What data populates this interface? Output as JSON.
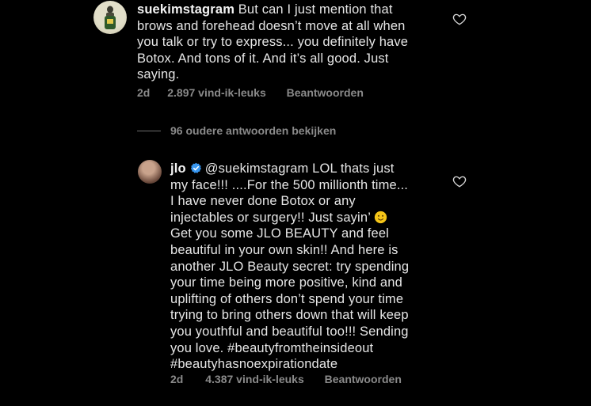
{
  "comments": {
    "parent": {
      "username": "suekimstagram",
      "lines": [
        " But can I just mention that",
        "brows and forehead doesn’t move at all when",
        "you talk or try to express... you definitely have",
        "Botox. And tons of it. And it’s all good.  Just",
        "saying."
      ],
      "time": "2d",
      "likes": "2.897 vind-ik-leuks",
      "reply_label": "Beantwoorden",
      "avatar_icon": "avatar-icon"
    },
    "view_replies_label": "96 oudere antwoorden bekijken",
    "reply": {
      "username": "jlo",
      "mention": "@suekimstagram",
      "lines": [
        "  LOL thats just",
        "my face!!! ....For the 500 millionth time...",
        "I have never done Botox or any",
        "injectables or surgery!! Just sayin’",
        "Get you some JLO BEAUTY and feel",
        "beautiful in your own skin!! And here is",
        "another JLO Beauty secret: try spending",
        "your time being more positive, kind and",
        "uplifting of others don’t spend your time",
        "trying to bring others down that will keep",
        "you youthful and beautiful too!!! Sending",
        "you love. #beautyfromtheinsideout",
        "#beautyhasnoexpirationdate"
      ],
      "time": "2d",
      "likes": "4.387 vind-ik-leuks",
      "reply_label": "Beantwoorden",
      "verified": true,
      "emoji": "slightly-smiling-face"
    }
  },
  "colors": {
    "background": "#000000",
    "text": "#e6e6e6",
    "meta": "#8a8a8a",
    "verified": "#3897f0",
    "emoji": "#f5c518"
  }
}
